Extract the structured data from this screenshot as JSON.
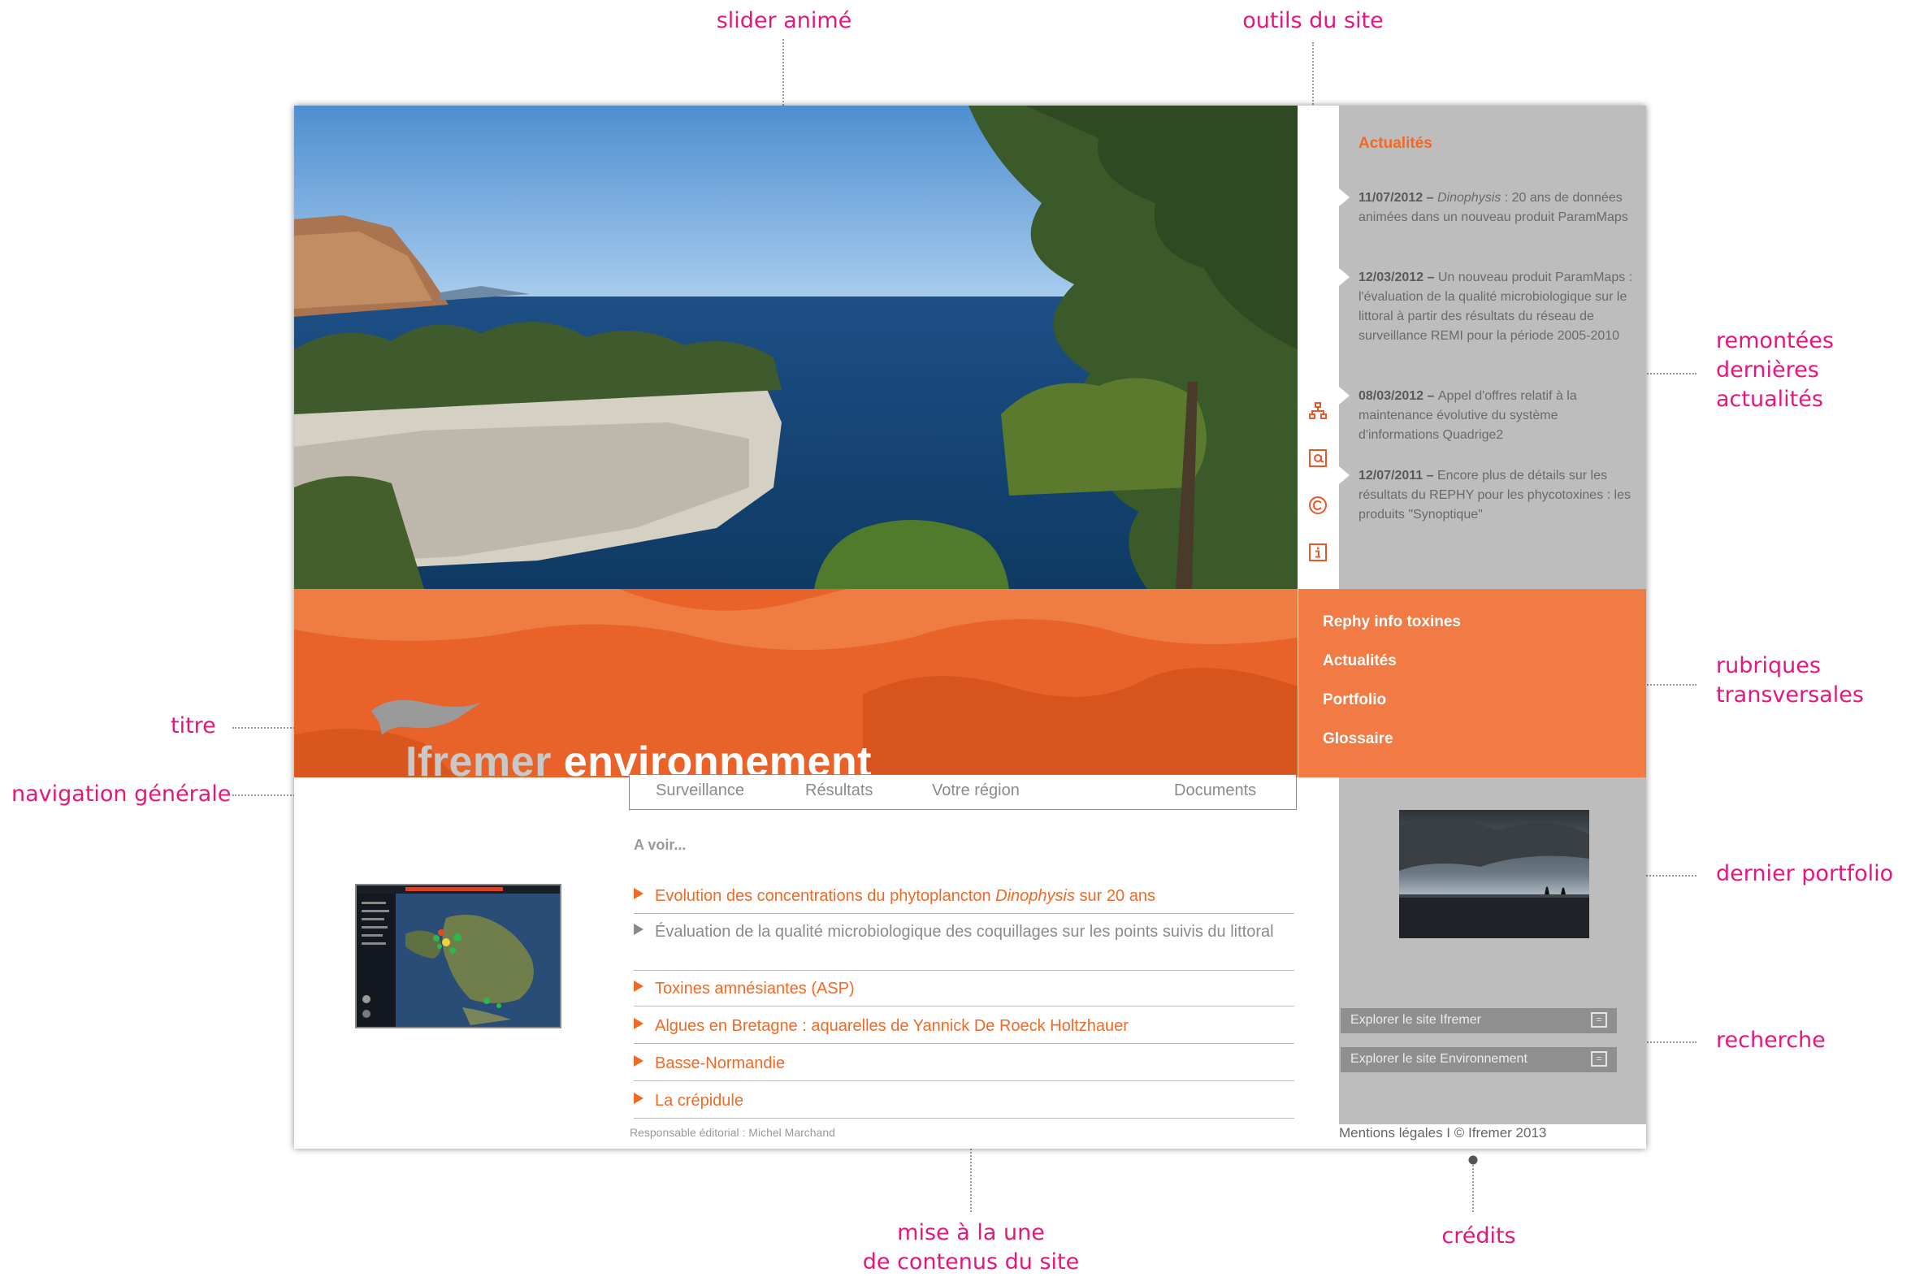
{
  "annotations": {
    "slider": "slider animé",
    "tools": "outils du site",
    "news_line1": "remontées",
    "news_line2": "dernières",
    "news_line3": "actualités",
    "rubriques_line1": "rubriques",
    "rubriques_line2": "transversales",
    "title": "titre",
    "navigation": "navigation générale",
    "portfolio": "dernier portfolio",
    "search": "recherche",
    "featured_line1": "mise à la une",
    "featured_line2": "de contenus du site",
    "credits": "crédits"
  },
  "site": {
    "title_light": "Ifremer",
    "title_bold": "environnement"
  },
  "tools": {
    "icons": [
      "sitemap-icon",
      "email-icon",
      "copyright-icon",
      "info-icon"
    ]
  },
  "news": {
    "heading": "Actualités",
    "items": [
      {
        "date": "11/07/2012",
        "sep": " – ",
        "emph": "Dinophysis",
        "text": " : 20 ans de données animées dans un nouveau produit ParamMaps"
      },
      {
        "date": "12/03/2012",
        "sep": " – ",
        "emph": "",
        "text": "Un nouveau produit ParamMaps : l'évaluation de la qualité microbiologique sur le littoral à partir des résultats du réseau de surveillance REMI pour la période 2005-2010"
      },
      {
        "date": "08/03/2012",
        "sep": " – ",
        "emph": "",
        "text": "Appel d'offres relatif à la maintenance évolutive du système d'informations Quadrige2"
      },
      {
        "date": "12/07/2011",
        "sep": " – ",
        "emph": "",
        "text": "Encore plus de détails sur les résultats du REPHY pour les phycotoxines : les produits \"Synoptique\""
      }
    ]
  },
  "rubriques": [
    "Rephy info toxines",
    "Actualités",
    "Portfolio",
    "Glossaire"
  ],
  "nav": [
    "Surveillance",
    "Résultats",
    "Votre région",
    "Documents"
  ],
  "featured": {
    "heading": "A voir...",
    "items": [
      {
        "pre": "Evolution des concentrations du phytoplancton ",
        "emph": "Dinophysis",
        "post": " sur 20 ans",
        "style": "orange"
      },
      {
        "pre": "Évaluation de la qualité microbiologique des coquillages sur les points suivis du littoral",
        "emph": "",
        "post": "",
        "style": "grey"
      },
      {
        "pre": "Toxines amnésiantes (ASP)",
        "emph": "",
        "post": "",
        "style": "orange"
      },
      {
        "pre": "Algues en Bretagne : aquarelles de Yannick De Roeck Holtzhauer",
        "emph": "",
        "post": "",
        "style": "orange"
      },
      {
        "pre": "Basse-Normandie",
        "emph": "",
        "post": "",
        "style": "orange"
      },
      {
        "pre": "La crépidule",
        "emph": "",
        "post": "",
        "style": "orange"
      }
    ]
  },
  "search": {
    "ifremer": "Explorer le site Ifremer",
    "environnement": "Explorer le site Environnement",
    "button_glyph": "="
  },
  "footer": {
    "editor": "Responsable éditorial : Michel Marchand",
    "credits": "Mentions légales I © Ifremer 2013"
  },
  "colors": {
    "annotation": "#e5177e",
    "accent_orange": "#f06a25",
    "banner_orange": "#e8622a",
    "sidebar_grey": "#bdbdbd"
  }
}
